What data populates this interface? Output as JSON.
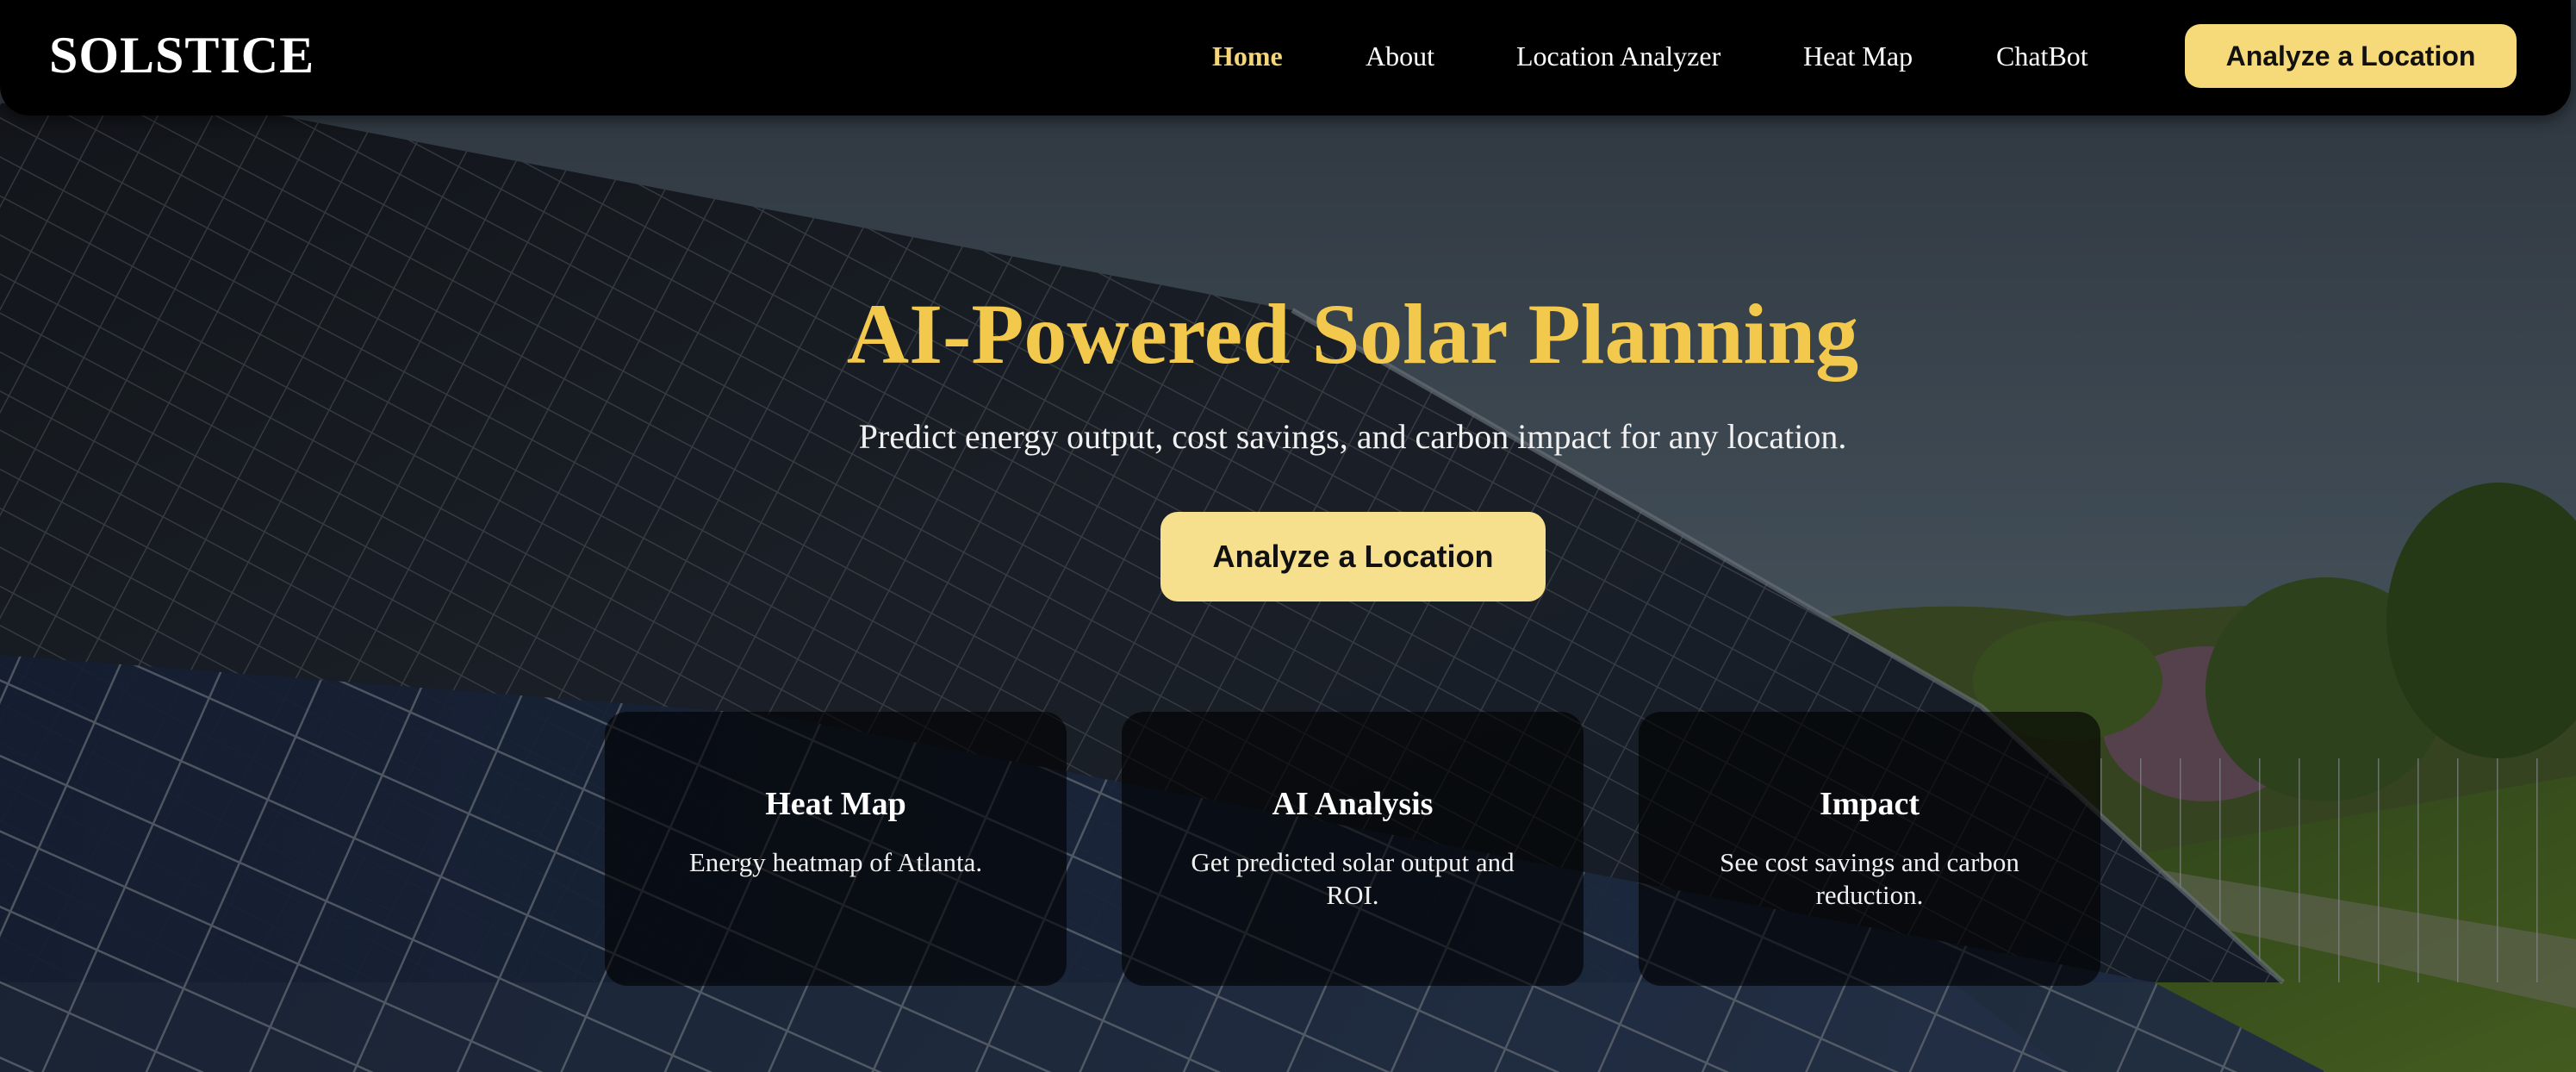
{
  "navbar": {
    "logo": "SOLSTICE",
    "links": [
      {
        "label": "Home",
        "active": true
      },
      {
        "label": "About",
        "active": false
      },
      {
        "label": "Location Analyzer",
        "active": false
      },
      {
        "label": "Heat Map",
        "active": false
      },
      {
        "label": "ChatBot",
        "active": false
      }
    ],
    "cta_label": "Analyze a Location"
  },
  "hero": {
    "title": "AI-Powered Solar Planning",
    "subtitle": "Predict energy output, cost savings, and carbon impact for any location.",
    "cta_label": "Analyze a Location",
    "background": "solar-panel-field-photo"
  },
  "features": [
    {
      "title": "Heat Map",
      "description": "Energy heatmap of Atlanta."
    },
    {
      "title": "AI Analysis",
      "description": "Get predicted solar output and ROI."
    },
    {
      "title": "Impact",
      "description": "See cost savings and carbon reduction."
    }
  ],
  "colors": {
    "accent": "#f2c94c",
    "button": "#f6d978",
    "nav_background": "#000000",
    "card_background": "rgba(0,0,0,0.62)"
  }
}
